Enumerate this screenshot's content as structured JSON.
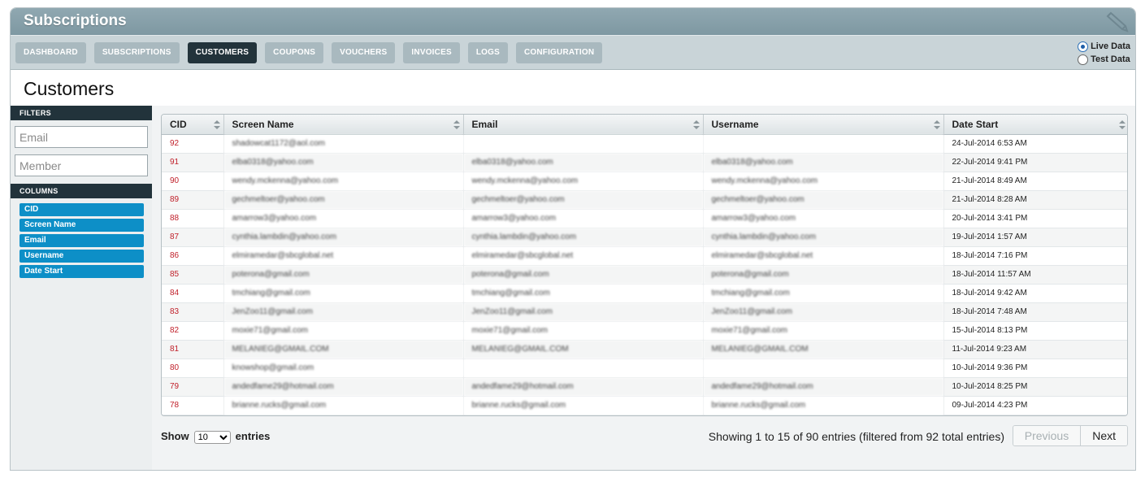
{
  "app": {
    "title": "Subscriptions"
  },
  "nav": {
    "tabs": [
      "DASHBOARD",
      "SUBSCRIPTIONS",
      "CUSTOMERS",
      "COUPONS",
      "VOUCHERS",
      "INVOICES",
      "LOGS",
      "CONFIGURATION"
    ],
    "active": "CUSTOMERS"
  },
  "data_source": {
    "live_label": "Live Data",
    "test_label": "Test Data",
    "selected": "Live Data"
  },
  "page": {
    "title": "Customers"
  },
  "sidebar": {
    "filters_label": "FILTERS",
    "email_placeholder": "Email",
    "member_placeholder": "Member",
    "columns_label": "COLUMNS",
    "columns": [
      "CID",
      "Screen Name",
      "Email",
      "Username",
      "Date Start"
    ]
  },
  "table": {
    "headers": [
      "CID",
      "Screen Name",
      "Email",
      "Username",
      "Date Start"
    ],
    "rows": [
      [
        "92",
        "shadowcat1172@aol.com",
        "",
        "",
        "24-Jul-2014 6:53 AM"
      ],
      [
        "91",
        "elba0318@yahoo.com",
        "elba0318@yahoo.com",
        "elba0318@yahoo.com",
        "22-Jul-2014 9:41 PM"
      ],
      [
        "90",
        "wendy.mckenna@yahoo.com",
        "wendy.mckenna@yahoo.com",
        "wendy.mckenna@yahoo.com",
        "21-Jul-2014 8:49 AM"
      ],
      [
        "89",
        "gechmeltoer@yahoo.com",
        "gechmeltoer@yahoo.com",
        "gechmeltoer@yahoo.com",
        "21-Jul-2014 8:28 AM"
      ],
      [
        "88",
        "amarrow3@yahoo.com",
        "amarrow3@yahoo.com",
        "amarrow3@yahoo.com",
        "20-Jul-2014 3:41 PM"
      ],
      [
        "87",
        "cynthia.lambdin@yahoo.com",
        "cynthia.lambdin@yahoo.com",
        "cynthia.lambdin@yahoo.com",
        "19-Jul-2014 1:57 AM"
      ],
      [
        "86",
        "elmiramedar@sbcglobal.net",
        "elmiramedar@sbcglobal.net",
        "elmiramedar@sbcglobal.net",
        "18-Jul-2014 7:16 PM"
      ],
      [
        "85",
        "poterona@gmail.com",
        "poterona@gmail.com",
        "poterona@gmail.com",
        "18-Jul-2014 11:57 AM"
      ],
      [
        "84",
        "tmchiang@gmail.com",
        "tmchiang@gmail.com",
        "tmchiang@gmail.com",
        "18-Jul-2014 9:42 AM"
      ],
      [
        "83",
        "JenZoo11@gmail.com",
        "JenZoo11@gmail.com",
        "JenZoo11@gmail.com",
        "18-Jul-2014 7:48 AM"
      ],
      [
        "82",
        "moxie71@gmail.com",
        "moxie71@gmail.com",
        "moxie71@gmail.com",
        "15-Jul-2014 8:13 PM"
      ],
      [
        "81",
        "MELANIEG@GMAIL.COM",
        "MELANIEG@GMAIL.COM",
        "MELANIEG@GMAIL.COM",
        "11-Jul-2014 9:23 AM"
      ],
      [
        "80",
        "knowshop@gmail.com",
        "",
        "",
        "10-Jul-2014 9:36 PM"
      ],
      [
        "79",
        "andedfame29@hotmail.com",
        "andedfame29@hotmail.com",
        "andedfame29@hotmail.com",
        "10-Jul-2014 8:25 PM"
      ],
      [
        "78",
        "brianne.rucks@gmail.com",
        "brianne.rucks@gmail.com",
        "brianne.rucks@gmail.com",
        "09-Jul-2014 4:23 PM"
      ]
    ]
  },
  "footer": {
    "show_label": "Show",
    "page_size": "10",
    "entries_label": "entries",
    "info": "Showing 1 to 15 of 90 entries (filtered from 92 total entries)",
    "previous_label": "Previous",
    "next_label": "Next"
  },
  "colors": {
    "active_tab": "#22333b",
    "column_chip": "#0d8fc7",
    "cid_text": "#c0202a"
  }
}
